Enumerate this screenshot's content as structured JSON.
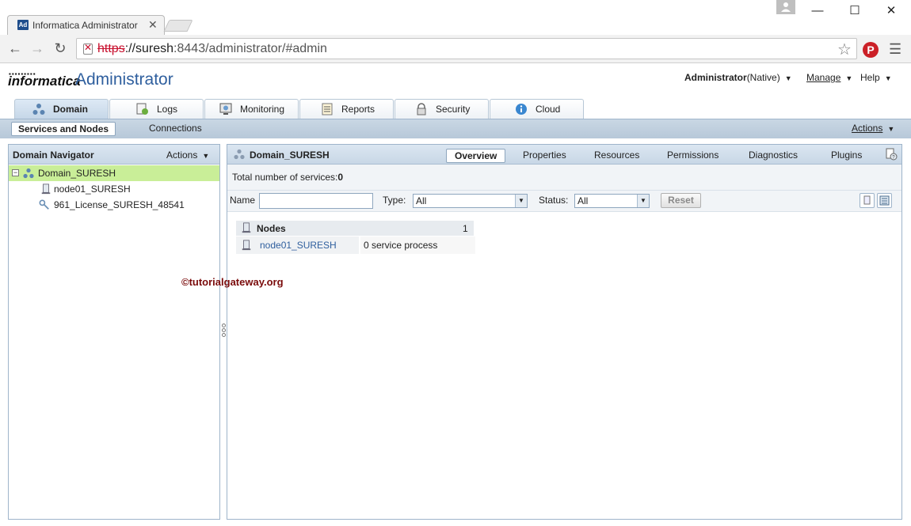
{
  "browser": {
    "tab_title": "Informatica Administrator",
    "tab_close": "✕",
    "favicon_text": "Ad",
    "url_scheme": "https",
    "url_host": "://suresh",
    "url_rest": ":8443/administrator/#admin",
    "window_minimize": "—",
    "window_maximize": "☐",
    "window_close": "✕",
    "back": "←",
    "forward": "→",
    "reload": "↻",
    "star": "☆",
    "menu": "☰",
    "pinterest": "P"
  },
  "header": {
    "brand": "informatica",
    "product": "Administrator",
    "user_name": "Administrator",
    "user_security": "(Native)",
    "manage_label": "Manage",
    "help_label": "Help",
    "caret": "▼"
  },
  "main_tabs": [
    {
      "label": "Domain",
      "icon": "domain-icon",
      "active": true
    },
    {
      "label": "Logs",
      "icon": "logs-icon",
      "active": false
    },
    {
      "label": "Monitoring",
      "icon": "monitoring-icon",
      "active": false
    },
    {
      "label": "Reports",
      "icon": "reports-icon",
      "active": false
    },
    {
      "label": "Security",
      "icon": "security-icon",
      "active": false
    },
    {
      "label": "Cloud",
      "icon": "cloud-icon",
      "active": false
    }
  ],
  "sub_tabs": [
    {
      "label": "Services and Nodes",
      "active": true
    },
    {
      "label": "Connections",
      "active": false
    }
  ],
  "sub_actions_label": "Actions",
  "navigator": {
    "title": "Domain Navigator",
    "actions_label": "Actions",
    "expander": "−",
    "items": [
      {
        "label": "Domain_SURESH",
        "icon": "domain-icon",
        "selected": true
      },
      {
        "label": "node01_SURESH",
        "icon": "node-icon",
        "selected": false
      },
      {
        "label": "961_License_SURESH_48541",
        "icon": "license-key-icon",
        "selected": false
      }
    ]
  },
  "content": {
    "title": "Domain_SURESH",
    "tabs": [
      "Overview",
      "Properties",
      "Resources",
      "Permissions",
      "Diagnostics",
      "Plugins"
    ],
    "active_tab": "Overview",
    "total_label": "Total number of services:",
    "total_value": "0",
    "filter": {
      "name_label": "Name",
      "name_value": "",
      "type_label": "Type:",
      "type_value": "All",
      "status_label": "Status:",
      "status_value": "All",
      "reset_label": "Reset"
    },
    "nodes": {
      "header_label": "Nodes",
      "count": "1",
      "rows": [
        {
          "name": "node01_SURESH",
          "detail": "0 service process"
        }
      ]
    }
  },
  "watermark": "©tutorialgateway.org",
  "colors": {
    "accent_blue": "#2f5f9e",
    "selected_green": "#c9ee98",
    "panel_header": "#c8d7e6",
    "watermark": "#7a0b0b"
  }
}
